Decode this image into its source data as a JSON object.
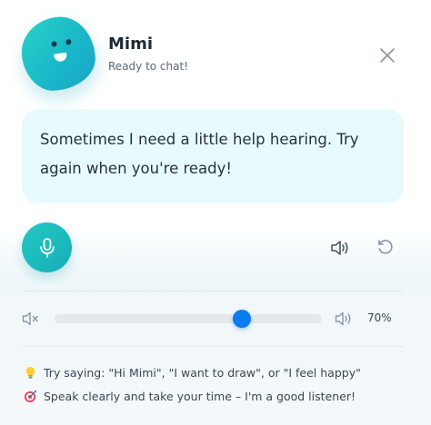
{
  "header": {
    "name": "Mimi",
    "status": "Ready to chat!"
  },
  "message": {
    "text": "Sometimes I need a little help hearing. Try again when you're ready!"
  },
  "volume": {
    "level": 0.7,
    "label": "70%"
  },
  "tips": [
    {
      "icon": "lightbulb-icon",
      "text": "Try saying: \"Hi Mimi\", \"I want to draw\", or \"I feel happy\""
    },
    {
      "icon": "target-icon",
      "text": "Speak clearly and take your time – I'm a good listener!"
    }
  ],
  "colors": {
    "accent": "#1fbfc2",
    "slider": "#0a7cf0",
    "bubble": "#e8fbfc"
  }
}
